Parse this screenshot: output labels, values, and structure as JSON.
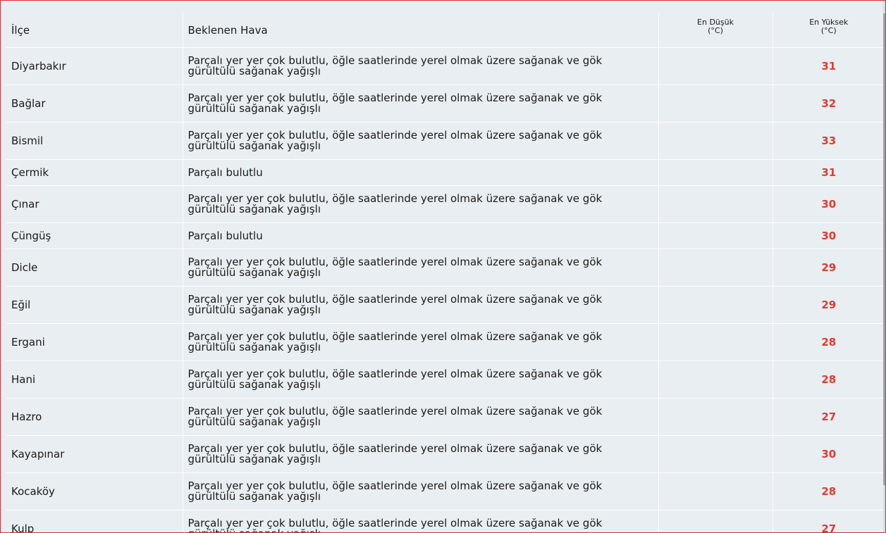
{
  "table": {
    "headers": {
      "district": "İlçe",
      "weather": "Beklenen Hava",
      "low_line1": "En Düşük",
      "low_line2": "(°C)",
      "high_line1": "En Yüksek",
      "high_line2": "(°C)"
    },
    "rows": [
      {
        "district": "Diyarbakır",
        "weather": "Parçalı yer yer çok bulutlu, öğle saatlerinde yerel olmak üzere sağanak ve gök gürültülü sağanak yağışlı",
        "low": "",
        "high": "31"
      },
      {
        "district": "Bağlar",
        "weather": "Parçalı yer yer çok bulutlu, öğle saatlerinde yerel olmak üzere sağanak ve gök gürültülü sağanak yağışlı",
        "low": "",
        "high": "32"
      },
      {
        "district": "Bismil",
        "weather": "Parçalı yer yer çok bulutlu, öğle saatlerinde yerel olmak üzere sağanak ve gök gürültülü sağanak yağışlı",
        "low": "",
        "high": "33"
      },
      {
        "district": "Çermik",
        "weather": "Parçalı bulutlu",
        "low": "",
        "high": "31"
      },
      {
        "district": "Çınar",
        "weather": "Parçalı yer yer çok bulutlu, öğle saatlerinde yerel olmak üzere sağanak ve gök gürültülü sağanak yağışlı",
        "low": "",
        "high": "30"
      },
      {
        "district": "Çüngüş",
        "weather": "Parçalı bulutlu",
        "low": "",
        "high": "30"
      },
      {
        "district": "Dicle",
        "weather": "Parçalı yer yer çok bulutlu, öğle saatlerinde yerel olmak üzere sağanak ve gök gürültülü sağanak yağışlı",
        "low": "",
        "high": "29"
      },
      {
        "district": "Eğil",
        "weather": "Parçalı yer yer çok bulutlu, öğle saatlerinde yerel olmak üzere sağanak ve gök gürültülü sağanak yağışlı",
        "low": "",
        "high": "29"
      },
      {
        "district": "Ergani",
        "weather": "Parçalı yer yer çok bulutlu, öğle saatlerinde yerel olmak üzere sağanak ve gök gürültülü sağanak yağışlı",
        "low": "",
        "high": "28"
      },
      {
        "district": "Hani",
        "weather": "Parçalı yer yer çok bulutlu, öğle saatlerinde yerel olmak üzere sağanak ve gök gürültülü sağanak yağışlı",
        "low": "",
        "high": "28"
      },
      {
        "district": "Hazro",
        "weather": "Parçalı yer yer çok bulutlu, öğle saatlerinde yerel olmak üzere sağanak ve gök gürültülü sağanak yağışlı",
        "low": "",
        "high": "27"
      },
      {
        "district": "Kayapınar",
        "weather": "Parçalı yer yer çok bulutlu, öğle saatlerinde yerel olmak üzere sağanak ve gök gürültülü sağanak yağışlı",
        "low": "",
        "high": "30"
      },
      {
        "district": "Kocaköy",
        "weather": "Parçalı yer yer çok bulutlu, öğle saatlerinde yerel olmak üzere sağanak ve gök gürültülü sağanak yağışlı",
        "low": "",
        "high": "28"
      },
      {
        "district": "Kulp",
        "weather": "Parçalı yer yer çok bulutlu, öğle saatlerinde yerel olmak üzere sağanak ve gök gürültülü sağanak yağışlı",
        "low": "",
        "high": "27"
      }
    ]
  },
  "colors": {
    "background": "#e8eef1",
    "high_temp": "#e03c31",
    "frame_border": "#d32f2f"
  }
}
